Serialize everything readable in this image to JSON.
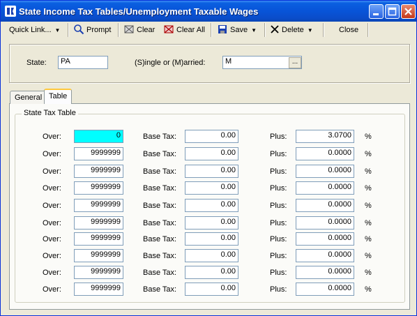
{
  "window": {
    "title": "State Income Tax Tables/Unemployment Taxable Wages"
  },
  "toolbar": {
    "quick_link": "Quick Link...",
    "prompt": "Prompt",
    "clear": "Clear",
    "clear_all": "Clear All",
    "save": "Save",
    "delete": "Delete",
    "close": "Close"
  },
  "header": {
    "state_label": "State:",
    "state_value": "PA",
    "marital_label": "(S)ingle or (M)arried:",
    "marital_value": "M",
    "browse_label": "..."
  },
  "tabs": {
    "general": "General",
    "table": "Table"
  },
  "table": {
    "group_title": "State Tax Table",
    "over_label": "Over:",
    "base_tax_label": "Base Tax:",
    "plus_label": "Plus:",
    "pct_label": "%",
    "rows": [
      {
        "over": "0",
        "base_tax": "0.00",
        "plus": "3.0700"
      },
      {
        "over": "9999999",
        "base_tax": "0.00",
        "plus": "0.0000"
      },
      {
        "over": "9999999",
        "base_tax": "0.00",
        "plus": "0.0000"
      },
      {
        "over": "9999999",
        "base_tax": "0.00",
        "plus": "0.0000"
      },
      {
        "over": "9999999",
        "base_tax": "0.00",
        "plus": "0.0000"
      },
      {
        "over": "9999999",
        "base_tax": "0.00",
        "plus": "0.0000"
      },
      {
        "over": "9999999",
        "base_tax": "0.00",
        "plus": "0.0000"
      },
      {
        "over": "9999999",
        "base_tax": "0.00",
        "plus": "0.0000"
      },
      {
        "over": "9999999",
        "base_tax": "0.00",
        "plus": "0.0000"
      },
      {
        "over": "9999999",
        "base_tax": "0.00",
        "plus": "0.0000"
      }
    ]
  }
}
